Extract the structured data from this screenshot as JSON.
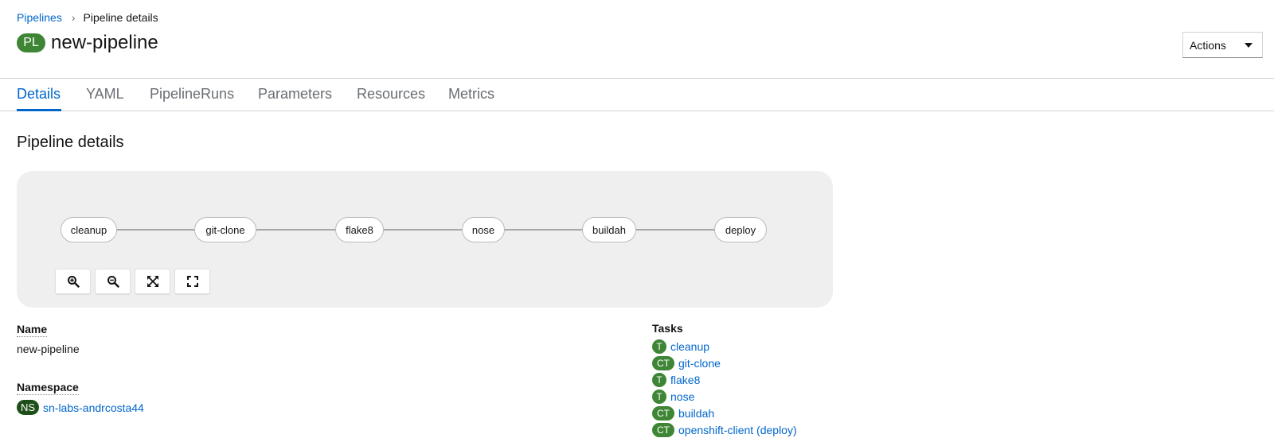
{
  "breadcrumb": {
    "parent": "Pipelines",
    "current": "Pipeline details"
  },
  "header": {
    "badge": "PL",
    "title": "new-pipeline",
    "actions_label": "Actions"
  },
  "tabs": [
    {
      "label": "Details"
    },
    {
      "label": "YAML"
    },
    {
      "label": "PipelineRuns"
    },
    {
      "label": "Parameters"
    },
    {
      "label": "Resources"
    },
    {
      "label": "Metrics"
    }
  ],
  "section_title": "Pipeline details",
  "topology": {
    "nodes": [
      "cleanup",
      "git-clone",
      "flake8",
      "nose",
      "buildah",
      "deploy"
    ],
    "controls": [
      "zoom-in-icon",
      "zoom-out-icon",
      "fit-to-screen-icon",
      "expand-icon"
    ]
  },
  "details": {
    "name_label": "Name",
    "name_value": "new-pipeline",
    "namespace_label": "Namespace",
    "namespace_badge": "NS",
    "namespace_value": "sn-labs-andrcosta44"
  },
  "tasks": {
    "label": "Tasks",
    "items": [
      {
        "badge": "T",
        "name": "cleanup"
      },
      {
        "badge": "CT",
        "name": "git-clone"
      },
      {
        "badge": "T",
        "name": "flake8"
      },
      {
        "badge": "T",
        "name": "nose"
      },
      {
        "badge": "CT",
        "name": "buildah"
      },
      {
        "badge": "CT",
        "name": "openshift-client (deploy)"
      }
    ]
  },
  "colors": {
    "link": "#0066cc",
    "badge_green": "#3e8635",
    "namespace_badge": "#1e4f18"
  }
}
